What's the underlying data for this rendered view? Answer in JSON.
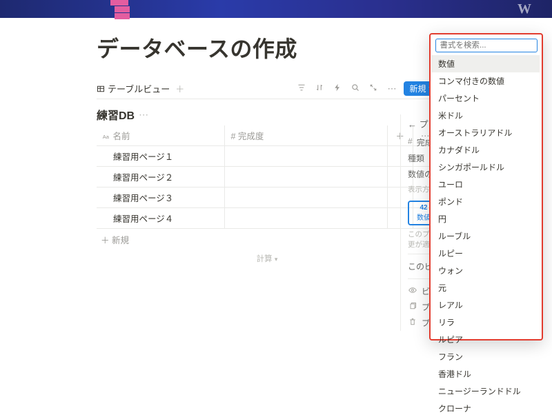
{
  "page_title": "データベースの作成",
  "view_tab": "テーブルビュー",
  "new_button": "新規",
  "db_name": "練習DB",
  "columns": {
    "name": "名前",
    "completion": "完成度"
  },
  "rows": [
    "練習用ページ１",
    "練習用ページ２",
    "練習用ページ３",
    "練習用ページ４"
  ],
  "add_row": "新規",
  "calc_label": "計算",
  "prop_panel": {
    "back": "プロパティ",
    "name_label": "完成度",
    "type_label": "種類",
    "format_label": "数値の形式",
    "display_label": "表示方法",
    "preview_top": "42",
    "preview_bottom": "数値",
    "note1": "このプロパティ",
    "note2": "更が適用されます",
    "view_section": "このビューで",
    "hide_in_view": "ビューで",
    "duplicate": "プロパティ",
    "delete": "プロパティ"
  },
  "format_search_placeholder": "書式を検索...",
  "format_options": [
    "数値",
    "コンマ付きの数値",
    "パーセント",
    "米ドル",
    "オーストラリアドル",
    "カナダドル",
    "シンガポールドル",
    "ユーロ",
    "ポンド",
    "円",
    "ルーブル",
    "ルピー",
    "ウォン",
    "元",
    "レアル",
    "リラ",
    "ルピア",
    "フラン",
    "香港ドル",
    "ニュージーランドドル",
    "クローナ"
  ],
  "format_selected_index": 0
}
